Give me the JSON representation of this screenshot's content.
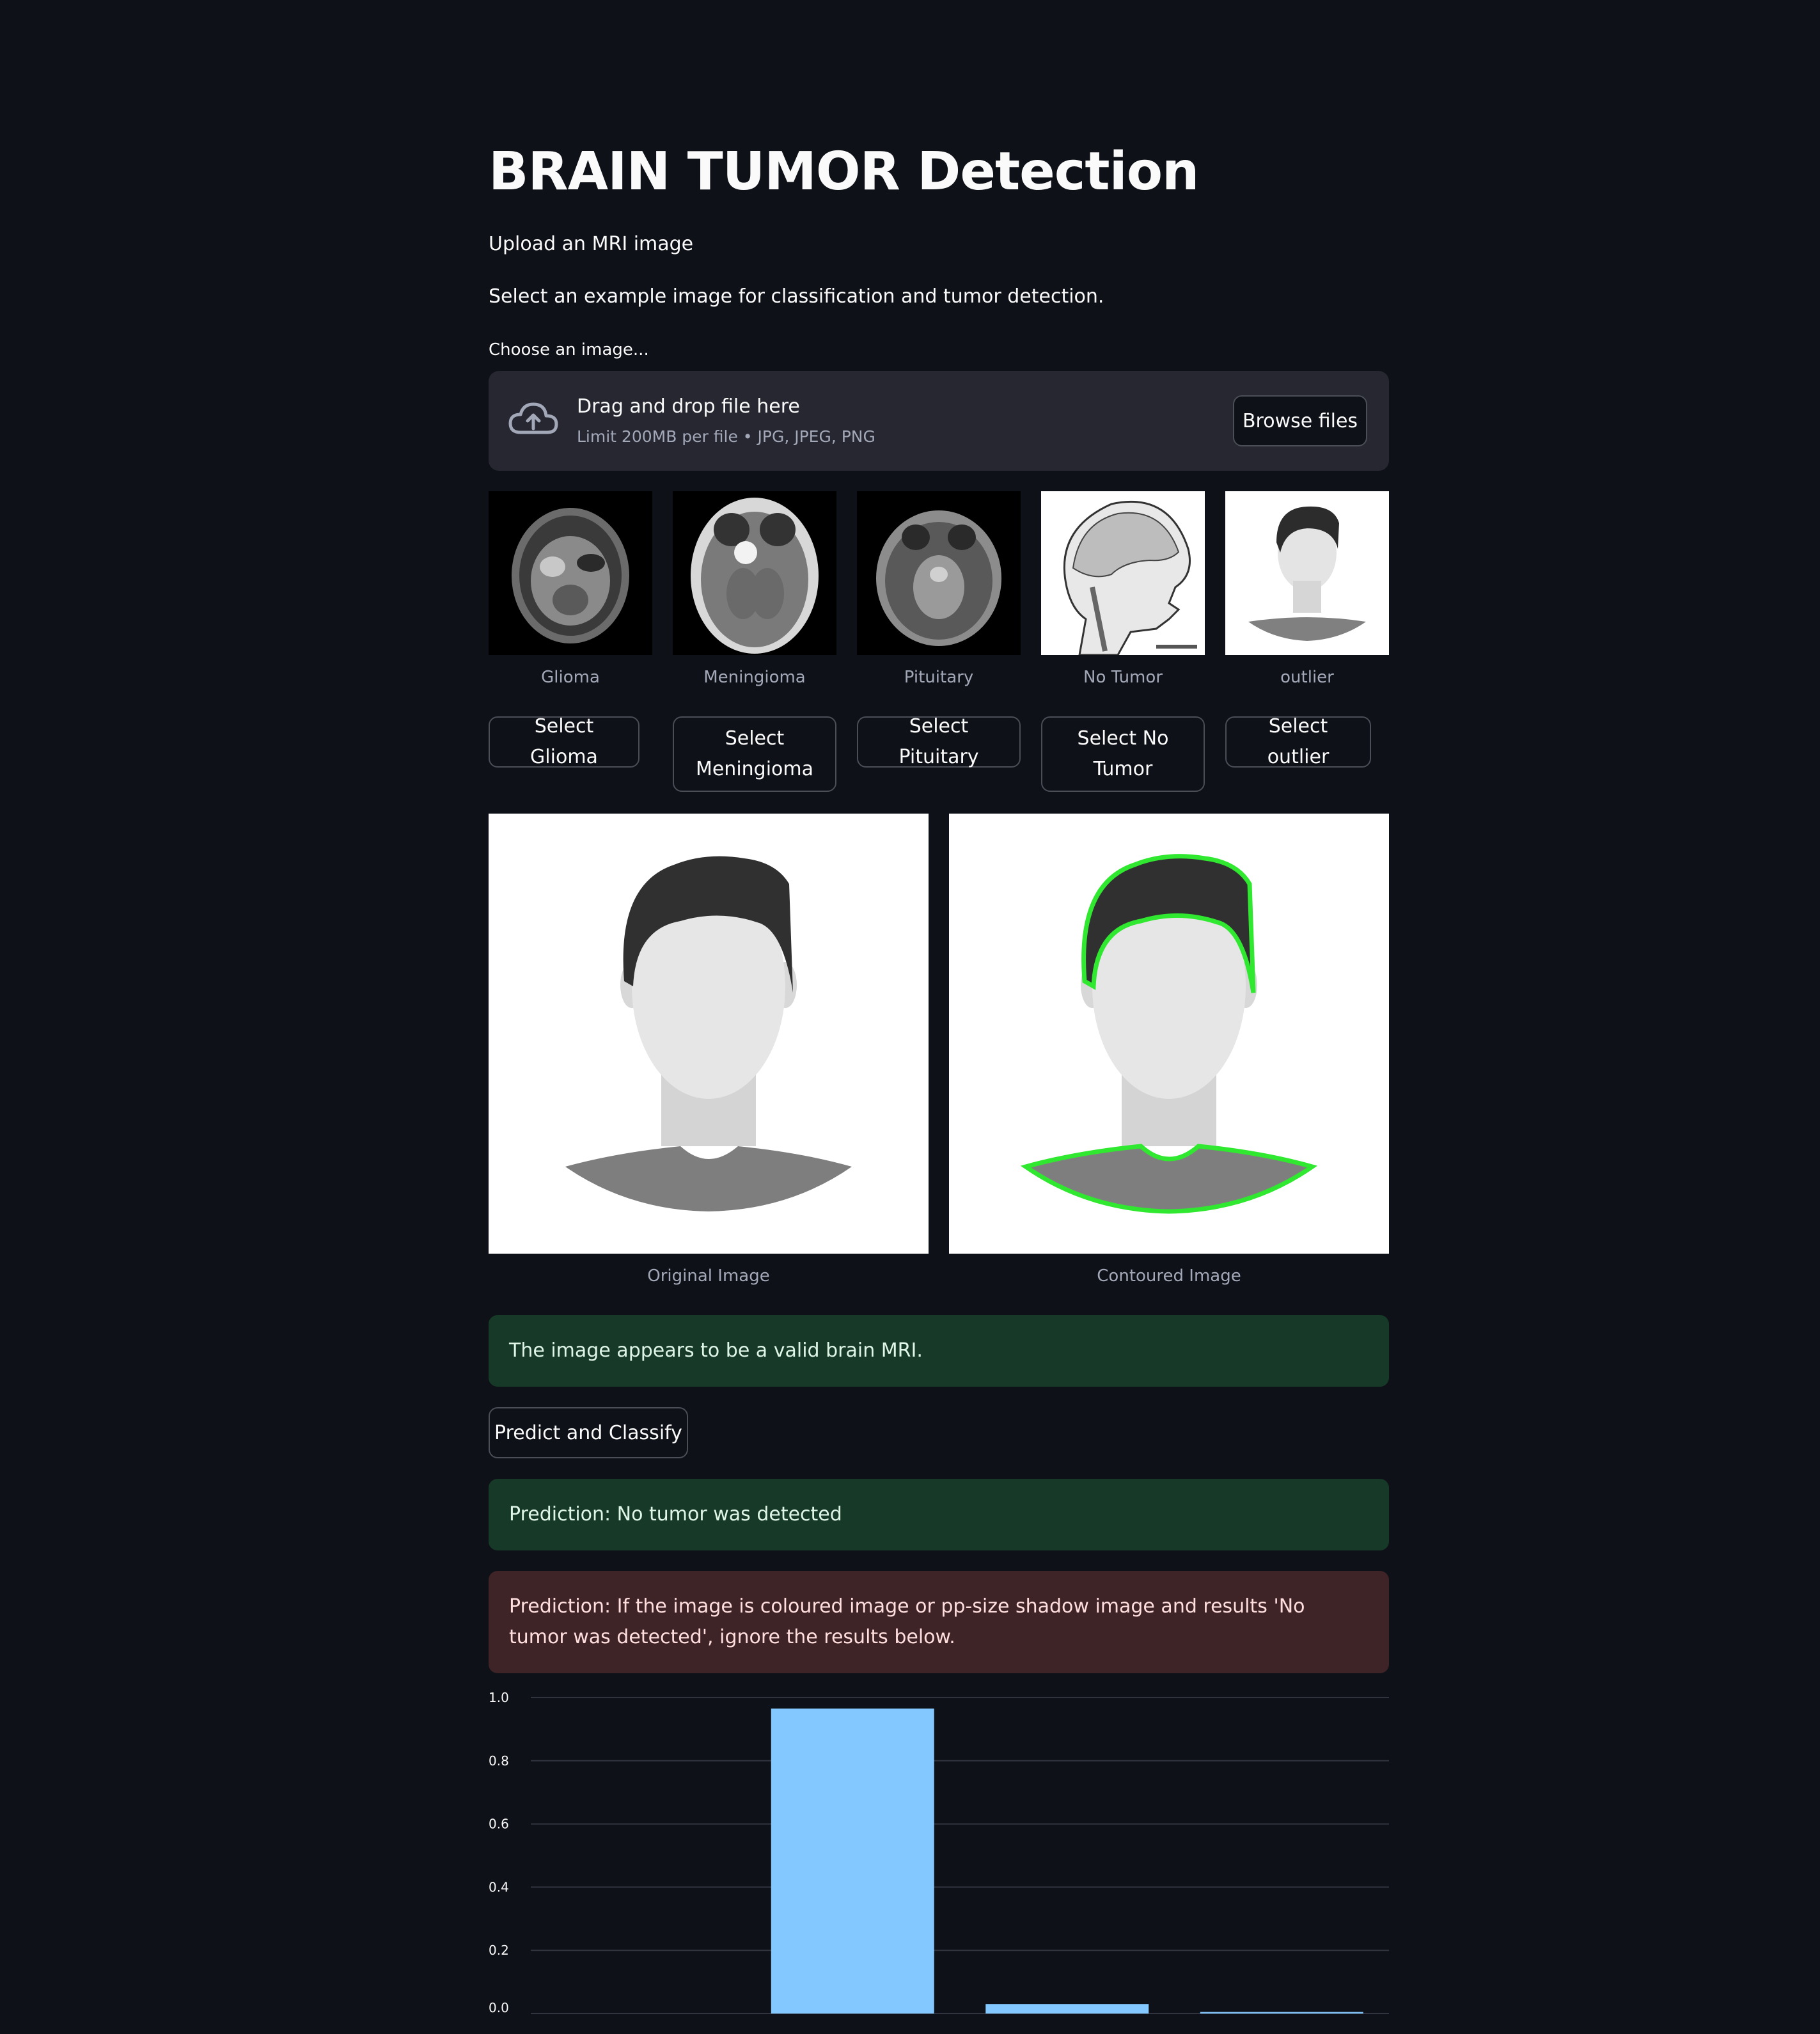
{
  "page": {
    "title": "BRAIN TUMOR Detection",
    "upload_text": "Upload an MRI image",
    "select_text": "Select an example image for classification and tumor detection."
  },
  "uploader": {
    "label": "Choose an image...",
    "drop_title": "Drag and drop file here",
    "limit_text": "Limit 200MB per file • JPG, JPEG, PNG",
    "browse_label": "Browse files",
    "icon": "cloud-upload-icon"
  },
  "examples": [
    {
      "caption": "Glioma",
      "button": "Select Glioma"
    },
    {
      "caption": "Meningioma",
      "button": "Select Meningioma"
    },
    {
      "caption": "Pituitary",
      "button": "Select Pituitary"
    },
    {
      "caption": "No Tumor",
      "button": "Select No Tumor"
    },
    {
      "caption": "outlier",
      "button": "Select outlier"
    }
  ],
  "images": {
    "original_caption": "Original Image",
    "contoured_caption": "Contoured Image"
  },
  "messages": {
    "valid": "The image appears to be a valid brain MRI.",
    "predict_button": "Predict and Classify",
    "prediction": "Prediction: No tumor was detected",
    "warning": "Prediction: If the image is coloured image or pp-size shadow image and results 'No tumor was detected', ignore the results below."
  },
  "colors": {
    "background": "#0e1117",
    "success_bg": "#173928",
    "error_bg": "#3e2327",
    "bar": "#83c9ff",
    "contour": "#2fe82f"
  },
  "chart_data": {
    "type": "bar",
    "categories": [
      "",
      "",
      "",
      ""
    ],
    "values": [
      0.0,
      0.965,
      0.03,
      0.005
    ],
    "ylim": [
      0,
      1.0
    ],
    "yticks": [
      "0.0",
      "0.2",
      "0.4",
      "0.6",
      "0.8",
      "1.0"
    ],
    "grid": true
  }
}
